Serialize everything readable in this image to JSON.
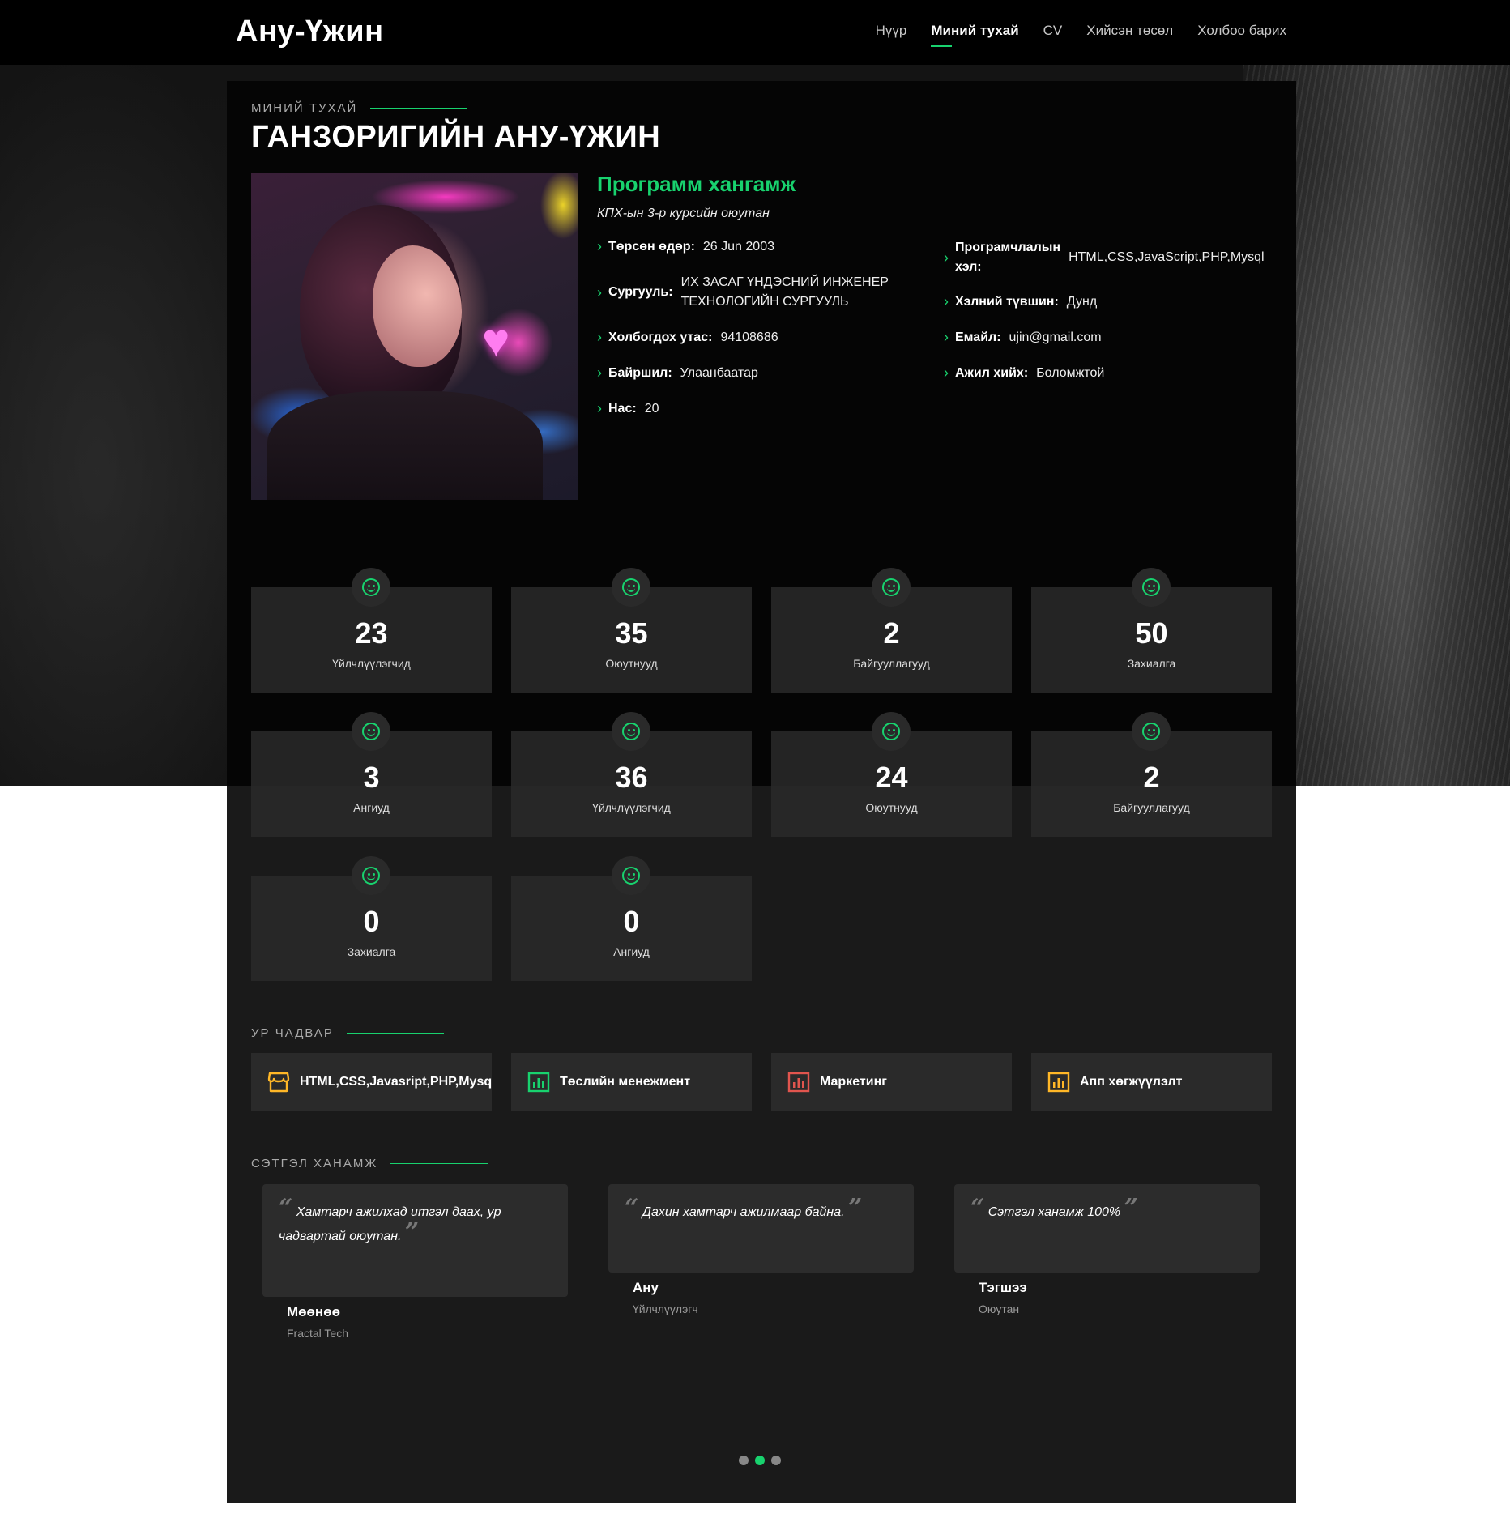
{
  "nav": {
    "brand": "Ану-Үжин",
    "links": [
      "Нүүр",
      "Миний тухай",
      "CV",
      "Хийсэн төсөл",
      "Холбоо барих"
    ],
    "active_index": 1
  },
  "about": {
    "section_label": "МИНИЙ ТУХАЙ",
    "name": "ГАНЗОРИГИЙН АНУ-ҮЖИН",
    "role": "Программ хангамж",
    "subtitle": "КПХ-ын 3-р курсийн оюутан",
    "left_info": [
      {
        "label": "Төрсөн өдөр:",
        "value": "26 Jun 2003"
      },
      {
        "label": "Сургууль:",
        "value_line1": "ИХ ЗАСАГ ҮНДЭСНИЙ ИНЖЕНЕР",
        "value_line2": "ТЕХНОЛОГИЙН СУРГУУЛЬ"
      },
      {
        "label": "Холбогдох утас:",
        "value": "94108686"
      },
      {
        "label": "Байршил:",
        "value": "Улаанбаатар"
      },
      {
        "label": "Нас:",
        "value": "20"
      }
    ],
    "right_info": [
      {
        "label_line1": "Програмчлалын",
        "label_line2": "хэл:",
        "value": "HTML,CSS,JavaScript,PHP,Mysql"
      },
      {
        "label": "Хэлний түвшин:",
        "value": "Дунд"
      },
      {
        "label": "Емайл:",
        "value": "ujin@gmail.com"
      },
      {
        "label": "Ажил хийх:",
        "value": "Боломжтой"
      }
    ]
  },
  "stats": [
    {
      "number": "23",
      "label": "Үйлчлүүлэгчид"
    },
    {
      "number": "35",
      "label": "Оюутнууд"
    },
    {
      "number": "2",
      "label": "Байгууллагууд"
    },
    {
      "number": "50",
      "label": "Захиалга"
    },
    {
      "number": "3",
      "label": "Ангиуд"
    },
    {
      "number": "36",
      "label": "Үйлчлүүлэгчид"
    },
    {
      "number": "24",
      "label": "Оюутнууд"
    },
    {
      "number": "2",
      "label": "Байгууллагууд"
    },
    {
      "number": "0",
      "label": "Захиалга"
    },
    {
      "number": "0",
      "label": "Ангиуд"
    }
  ],
  "skills": {
    "section_label": "УР ЧАДВАР",
    "items": [
      {
        "name": "HTML,CSS,Javasript,PHP,Mysql",
        "icon": "store-icon",
        "color": "#ffb727"
      },
      {
        "name": "Төслийн менежмент",
        "icon": "bar-chart-icon",
        "color": "#18d26e"
      },
      {
        "name": "Маркетинг",
        "icon": "bar-chart-icon",
        "color": "#e1554e"
      },
      {
        "name": "Апп хөгжүүлэлт",
        "icon": "bar-chart-icon",
        "color": "#ffb727"
      }
    ]
  },
  "testimonials": {
    "section_label": "СЭТГЭЛ ХАНАМЖ",
    "items": [
      {
        "text_line1": "Хамтарч ажилхад итгэл даах, ур",
        "text_line2": "чадвартай оюутан.",
        "name": "Мөөнөө",
        "role": "Fractal Tech"
      },
      {
        "text": "Дахин хамтарч ажилмаар байна.",
        "name": "Ану",
        "role": "Үйлчлүүлэгч"
      },
      {
        "text": "Сэтгэл ханамж 100%",
        "name": "Тэгшээ",
        "role": "Оюутан"
      }
    ],
    "dots": 3,
    "active_dot": 1
  },
  "colors": {
    "accent": "#18d26e",
    "panel": "#1a1a1a",
    "card": "#2a2a2a"
  }
}
